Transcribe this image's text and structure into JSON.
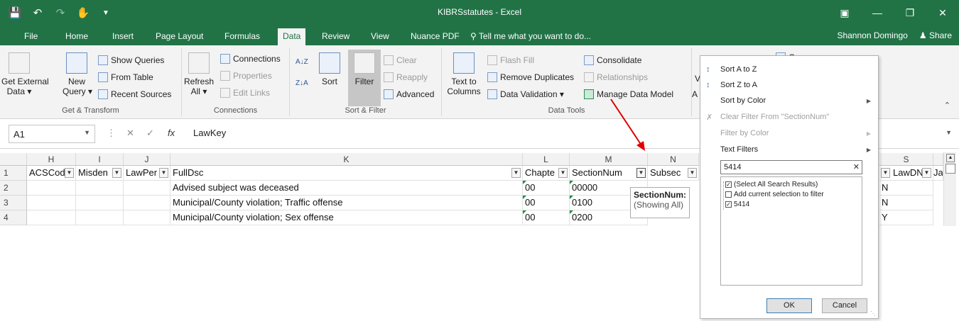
{
  "window": {
    "title": "KIBRSstatutes - Excel",
    "user": "Shannon Domingo",
    "share": "Share"
  },
  "tabs": [
    "File",
    "Home",
    "Insert",
    "Page Layout",
    "Formulas",
    "Data",
    "Review",
    "View",
    "Nuance PDF"
  ],
  "tell_me": "Tell me what you want to do...",
  "ribbon": {
    "get_external_data": "Get External",
    "get_external_data2": "Data",
    "new_query": "New",
    "new_query2": "Query",
    "show_queries": "Show Queries",
    "from_table": "From Table",
    "recent_sources": "Recent Sources",
    "get_transform": "Get & Transform",
    "refresh": "Refresh",
    "refresh2": "All",
    "connections": "Connections",
    "properties": "Properties",
    "edit_links": "Edit Links",
    "connections_group": "Connections",
    "sort": "Sort",
    "filter": "Filter",
    "clear": "Clear",
    "reapply": "Reapply",
    "advanced": "Advanced",
    "sort_filter_group": "Sort & Filter",
    "text_to_columns": "Text to",
    "text_to_columns2": "Columns",
    "flash_fill": "Flash Fill",
    "remove_duplicates": "Remove Duplicates",
    "data_validation": "Data Validation",
    "consolidate": "Consolidate",
    "relationships": "Relationships",
    "manage_data_model": "Manage Data Model",
    "data_tools_group": "Data Tools",
    "group": "Group",
    "what_if_partial": "V",
    "what_if_partial2": "A"
  },
  "formula_bar": {
    "name_box": "A1",
    "formula": "LawKey"
  },
  "columns": [
    "H",
    "I",
    "J",
    "K",
    "L",
    "M",
    "N",
    "S"
  ],
  "row_numbers": [
    "1",
    "2",
    "3",
    "4"
  ],
  "headers": {
    "h": "ACSCod",
    "i": "Misden",
    "j": "LawPer",
    "k": "FullDsc",
    "l": "Chapte",
    "m": "SectionNum",
    "n": "Subsec",
    "s": "LawDN",
    "t": "Jag"
  },
  "rows": [
    {
      "k": "Advised subject was deceased",
      "l": "00",
      "m": "00000",
      "s": "N"
    },
    {
      "k": "Municipal/County violation; Traffic offense",
      "l": "00",
      "m": "0100",
      "s": "N"
    },
    {
      "k": "Municipal/County violation; Sex offense",
      "l": "00",
      "m": "0200",
      "s": "Y"
    }
  ],
  "tooltip": {
    "title": "SectionNum:",
    "subtitle": "(Showing All)"
  },
  "filter_menu": {
    "sort_az": "Sort A to Z",
    "sort_za": "Sort Z to A",
    "sort_by_color": "Sort by Color",
    "clear_filter": "Clear Filter From \"SectionNum\"",
    "filter_by_color": "Filter by Color",
    "text_filters": "Text Filters",
    "search_value": "5414",
    "items": [
      {
        "label": "(Select All Search Results)",
        "checked": true
      },
      {
        "label": "Add current selection to filter",
        "checked": false
      },
      {
        "label": "5414",
        "checked": true
      }
    ],
    "ok": "OK",
    "cancel": "Cancel"
  },
  "colors": {
    "excel_green": "#217346",
    "arrow_red": "#e00000"
  }
}
